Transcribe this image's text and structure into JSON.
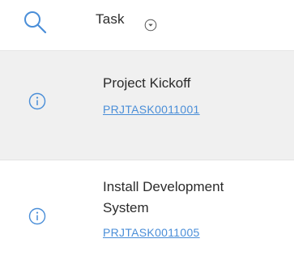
{
  "header": {
    "column_title": "Task",
    "search_icon": "search-icon",
    "sort_icon": "chevron-down-circle-icon"
  },
  "colors": {
    "accent": "#4a8ed8",
    "selected_row_bg": "#f0f0f0",
    "text": "#2b2b2b"
  },
  "rows": [
    {
      "icon": "info-icon",
      "name_lines": [
        "Project Kickoff"
      ],
      "number": "PRJTASK0011001",
      "selected": true
    },
    {
      "icon": "info-icon",
      "name_lines": [
        "Install Development",
        "System"
      ],
      "number": "PRJTASK0011005",
      "selected": false
    }
  ]
}
